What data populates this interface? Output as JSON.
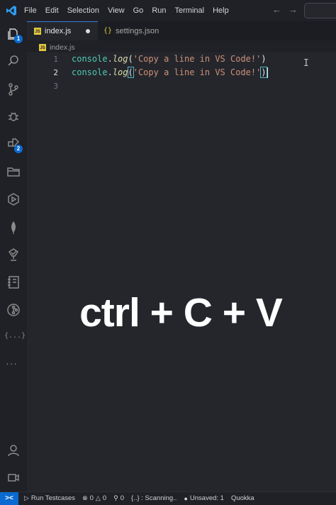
{
  "menubar": {
    "items": [
      "File",
      "Edit",
      "Selection",
      "View",
      "Go",
      "Run",
      "Terminal",
      "Help"
    ]
  },
  "nav": {
    "back_icon": "arrow-left-icon",
    "forward_icon": "arrow-right-icon"
  },
  "activity_bar": {
    "icons": [
      "explorer-icon",
      "search-icon",
      "source-control-icon",
      "debug-icon",
      "extensions-icon",
      "folder-icon",
      "play-icon",
      "mongodb-leaf-icon",
      "test-icon",
      "notebook-icon",
      "git-graph-icon",
      "json-braces-icon",
      "more-icon",
      "account-icon",
      "remote-icon"
    ],
    "explorer_badge": "1",
    "extensions_badge": "2",
    "json_braces_label": "{...}",
    "more_label": "···"
  },
  "tabs": [
    {
      "label": "index.js",
      "icon": "JS",
      "active": true,
      "dirty": true
    },
    {
      "label": "settings.json",
      "icon": "{}",
      "active": false
    }
  ],
  "breadcrumb": {
    "file": "index.js"
  },
  "editor": {
    "lines": [
      {
        "number": "1",
        "object": "console",
        "dot": ".",
        "method": "log",
        "open": "(",
        "string": "'Copy a line in VS Code!'",
        "close": ")"
      },
      {
        "number": "2",
        "object": "console",
        "dot": ".",
        "method": "log",
        "open": "(",
        "string": "'Copy a line in VS Code!'",
        "close": ")"
      },
      {
        "number": "3"
      }
    ]
  },
  "overlay": {
    "caption": "ctrl + C + V"
  },
  "statusbar": {
    "remote_label": "><",
    "run_testcases": "Run Testcases",
    "errors": "0",
    "warnings": "0",
    "ports": "0",
    "scanning": "{..} : Scanning..",
    "unsaved": "Unsaved: 1",
    "quokka": "Quokka"
  },
  "colors": {
    "background": "#1f2127",
    "editor_background": "#24262c",
    "accent": "#0a6ad1",
    "object": "#4ec9b0",
    "method": "#dcdcaa",
    "string": "#ce9178",
    "caption": "#ffffff"
  }
}
